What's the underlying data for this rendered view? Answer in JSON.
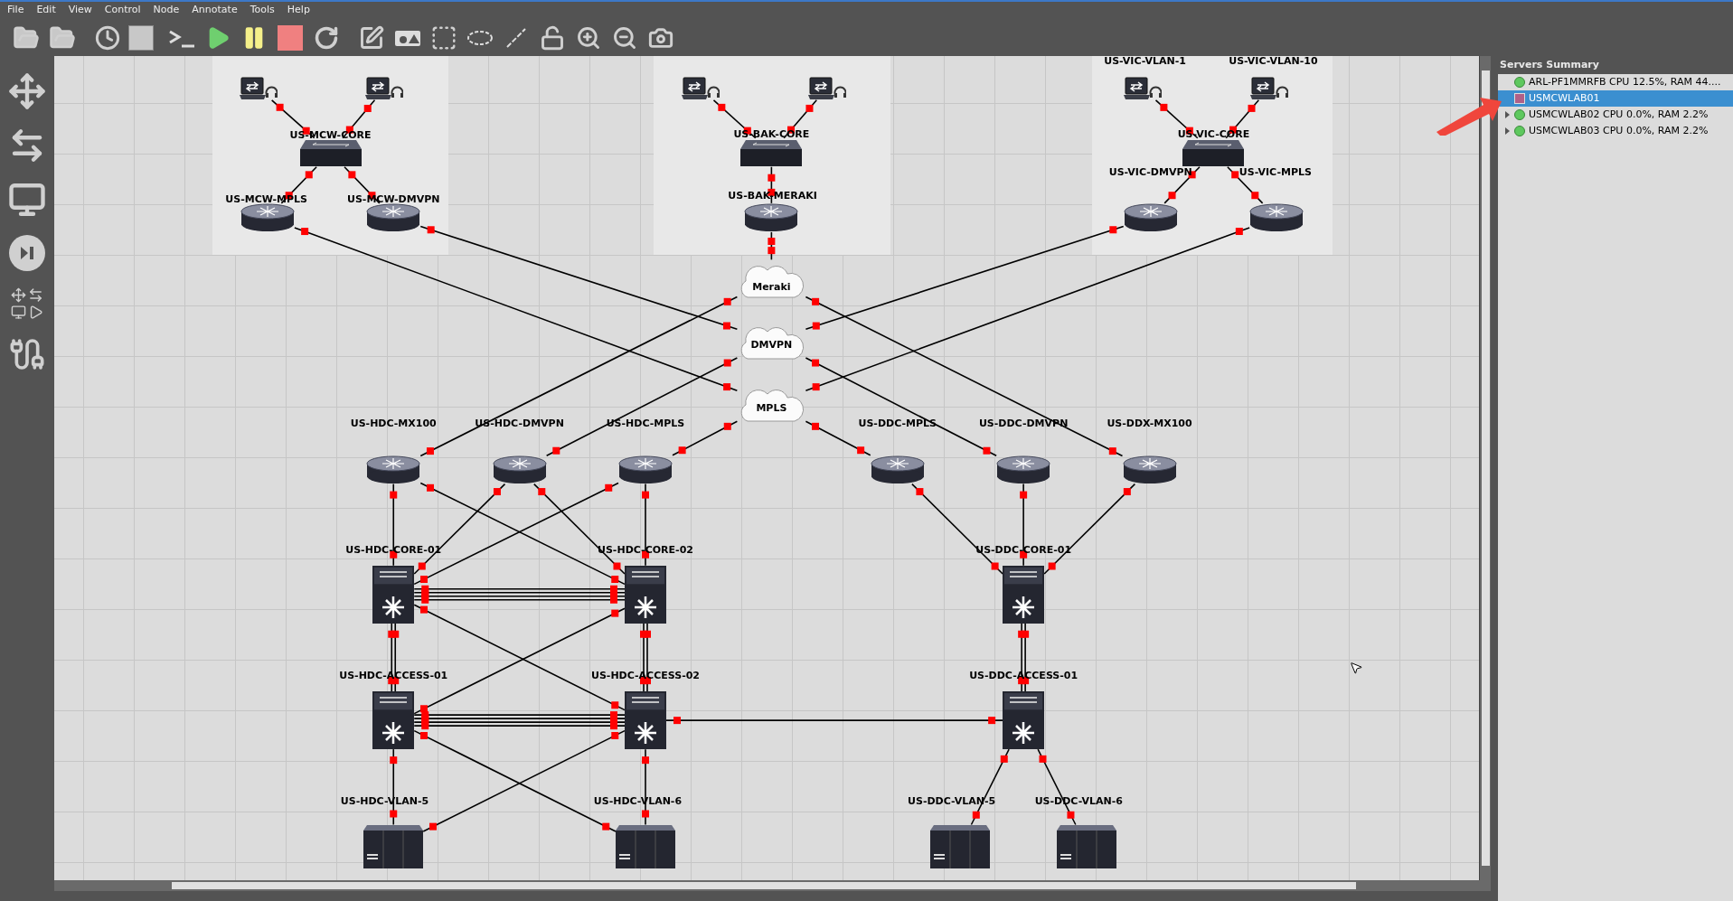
{
  "menu": [
    "File",
    "Edit",
    "View",
    "Control",
    "Node",
    "Annotate",
    "Tools",
    "Help"
  ],
  "topology": {
    "nodes": [
      {
        "kind": "laptop"
      },
      {
        "kind": "laptop"
      },
      {
        "kind": "switch",
        "label": "US-MCW-CORE"
      },
      {
        "kind": "router",
        "label": "US-MCW-MPLS"
      },
      {
        "kind": "router",
        "label": "US-MCW-DMVPN"
      },
      {
        "kind": "laptop"
      },
      {
        "kind": "laptop"
      },
      {
        "kind": "switch",
        "label": "US-BAK-CORE"
      },
      {
        "kind": "router",
        "label": "US-BAK-MERAKI"
      },
      {
        "kind": "laptop",
        "label": "US-VIC-VLAN-1"
      },
      {
        "kind": "laptop",
        "label": "US-VIC-VLAN-10"
      },
      {
        "kind": "switch",
        "label": "US-VIC-CORE"
      },
      {
        "kind": "router",
        "label": "US-VIC-DMVPN"
      },
      {
        "kind": "router",
        "label": "US-VIC-MPLS"
      },
      {
        "kind": "cloud",
        "label": "Meraki"
      },
      {
        "kind": "cloud",
        "label": "DMVPN"
      },
      {
        "kind": "cloud",
        "label": "MPLS"
      },
      {
        "kind": "router",
        "label": "US-HDC-MX100"
      },
      {
        "kind": "router",
        "label": "US-HDC-DMVPN"
      },
      {
        "kind": "router",
        "label": "US-HDC-MPLS"
      },
      {
        "kind": "router",
        "label": "US-DDC-MPLS"
      },
      {
        "kind": "router",
        "label": "US-DDC-DMVPN"
      },
      {
        "kind": "router",
        "label": "US-DDX-MX100"
      },
      {
        "kind": "multilayer",
        "label": "US-HDC-CORE-01"
      },
      {
        "kind": "multilayer",
        "label": "US-HDC-CORE-02"
      },
      {
        "kind": "multilayer",
        "label": "US-DDC-CORE-01"
      },
      {
        "kind": "multilayer",
        "label": "US-HDC-ACCESS-01"
      },
      {
        "kind": "multilayer",
        "label": "US-HDC-ACCESS-02"
      },
      {
        "kind": "multilayer",
        "label": "US-DDC-ACCESS-01"
      },
      {
        "kind": "server",
        "label": "US-HDC-VLAN-5"
      },
      {
        "kind": "server",
        "label": "US-HDC-VLAN-6"
      },
      {
        "kind": "server",
        "label": "US-DDC-VLAN-5"
      },
      {
        "kind": "server",
        "label": "US-DDC-VLAN-6"
      }
    ]
  },
  "servers_summary": {
    "title": "Servers Summary",
    "servers": [
      {
        "name": "ARL-PF1MMRFB CPU 12.5%, RAM 44....",
        "kind": "running",
        "selected": false,
        "expandable": false
      },
      {
        "name": "USMCWLAB01",
        "kind": "stopped",
        "selected": true,
        "expandable": false
      },
      {
        "name": "USMCWLAB02 CPU 0.0%, RAM 2.2%",
        "kind": "running",
        "selected": false,
        "expandable": true
      },
      {
        "name": "USMCWLAB03 CPU 0.0%, RAM 2.2%",
        "kind": "running",
        "selected": false,
        "expandable": true
      }
    ]
  }
}
